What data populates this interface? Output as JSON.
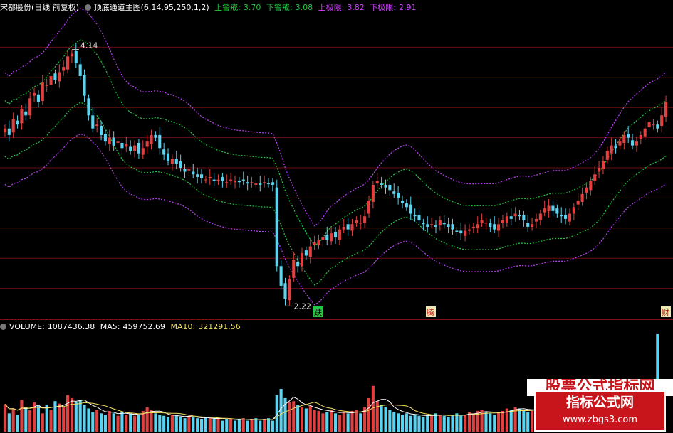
{
  "main_header": {
    "stock": "宋都股份(日线 前复权)",
    "indicator": "顶底通道主图(6,14,95,250,1,2)",
    "upper_warn_label": "上警戒:",
    "upper_warn_value": "3.70",
    "lower_warn_label": "下警戒:",
    "lower_warn_value": "3.08",
    "upper_limit_label": "上极限:",
    "upper_limit_value": "3.82",
    "lower_limit_label": "下极限:",
    "lower_limit_value": "2.91"
  },
  "volume_header": {
    "volume_label": "VOLUME:",
    "volume_value": "1087436.38",
    "ma5_label": "MA5:",
    "ma5_value": "459752.69",
    "ma10_label": "MA10:",
    "ma10_value": "321291.56"
  },
  "signals": [
    "跌",
    "腾",
    "财"
  ],
  "watermark": {
    "top_text": "股票公式指标网",
    "title": "指标公式网",
    "url": "www.zbgs3.com"
  },
  "colors": {
    "up_candle": "#e04040",
    "down_candle": "#5ad4f0",
    "warn_band": "#22c840",
    "limit_band": "#c040ff",
    "grid": "#6a1010",
    "separator": "#a01818"
  },
  "chart_data": {
    "type": "candlestick",
    "price_ylim": [
      2.1,
      4.4
    ],
    "price_annotations": [
      {
        "text": "4.14",
        "index": 16
      },
      {
        "text": "2.22",
        "index": 67
      }
    ],
    "close": [
      3.55,
      3.5,
      3.62,
      3.58,
      3.7,
      3.65,
      3.78,
      3.82,
      3.75,
      3.9,
      3.88,
      3.95,
      3.92,
      3.98,
      4.02,
      4.1,
      4.12,
      4.05,
      3.95,
      3.8,
      3.65,
      3.55,
      3.58,
      3.5,
      3.45,
      3.48,
      3.42,
      3.45,
      3.4,
      3.43,
      3.38,
      3.42,
      3.36,
      3.4,
      3.45,
      3.5,
      3.48,
      3.4,
      3.35,
      3.3,
      3.32,
      3.28,
      3.25,
      3.22,
      3.24,
      3.2,
      3.18,
      3.17,
      3.16,
      3.18,
      3.15,
      3.16,
      3.15,
      3.14,
      3.16,
      3.15,
      3.14,
      3.15,
      3.13,
      3.14,
      3.13,
      3.12,
      3.14,
      3.13,
      3.12,
      2.5,
      2.35,
      2.25,
      2.4,
      2.55,
      2.5,
      2.6,
      2.58,
      2.65,
      2.68,
      2.7,
      2.72,
      2.7,
      2.75,
      2.72,
      2.78,
      2.8,
      2.78,
      2.82,
      2.85,
      2.83,
      2.88,
      3.0,
      3.12,
      3.15,
      3.12,
      3.1,
      3.08,
      3.05,
      3.02,
      2.98,
      2.95,
      2.9,
      2.88,
      2.85,
      2.82,
      2.8,
      2.82,
      2.8,
      2.85,
      2.82,
      2.8,
      2.78,
      2.76,
      2.75,
      2.77,
      2.78,
      2.8,
      2.82,
      2.85,
      2.83,
      2.8,
      2.78,
      2.82,
      2.85,
      2.88,
      2.86,
      2.9,
      2.88,
      2.85,
      2.8,
      2.82,
      2.86,
      2.9,
      2.94,
      2.96,
      2.92,
      2.9,
      2.88,
      2.86,
      2.9,
      2.95,
      3.0,
      3.05,
      3.1,
      3.15,
      3.2,
      3.25,
      3.3,
      3.38,
      3.42,
      3.4,
      3.45,
      3.5,
      3.48,
      3.42,
      3.45,
      3.5,
      3.55,
      3.6,
      3.58,
      3.55,
      3.65,
      3.75
    ],
    "volume": [
      45,
      30,
      38,
      28,
      52,
      40,
      35,
      48,
      42,
      30,
      44,
      36,
      50,
      46,
      40,
      60,
      55,
      48,
      52,
      44,
      38,
      32,
      36,
      30,
      28,
      34,
      30,
      26,
      32,
      28,
      30,
      26,
      28,
      34,
      40,
      36,
      30,
      28,
      26,
      24,
      28,
      26,
      24,
      22,
      26,
      24,
      22,
      20,
      24,
      22,
      20,
      22,
      18,
      20,
      22,
      18,
      20,
      22,
      18,
      20,
      22,
      18,
      20,
      22,
      18,
      60,
      70,
      55,
      48,
      50,
      44,
      40,
      38,
      42,
      36,
      34,
      30,
      32,
      36,
      30,
      28,
      32,
      30,
      34,
      36,
      30,
      40,
      55,
      75,
      50,
      44,
      40,
      36,
      32,
      30,
      28,
      30,
      26,
      28,
      26,
      24,
      28,
      26,
      30,
      28,
      26,
      24,
      28,
      30,
      26,
      28,
      32,
      30,
      34,
      36,
      32,
      30,
      28,
      32,
      34,
      38,
      36,
      40,
      38,
      36,
      32,
      34,
      40,
      44,
      42,
      40,
      38,
      36,
      40,
      44,
      48,
      50,
      46,
      52,
      48,
      56,
      54,
      60,
      58,
      52,
      56,
      60,
      55,
      50,
      58,
      62,
      66,
      60,
      58,
      70,
      75,
      160
    ]
  }
}
